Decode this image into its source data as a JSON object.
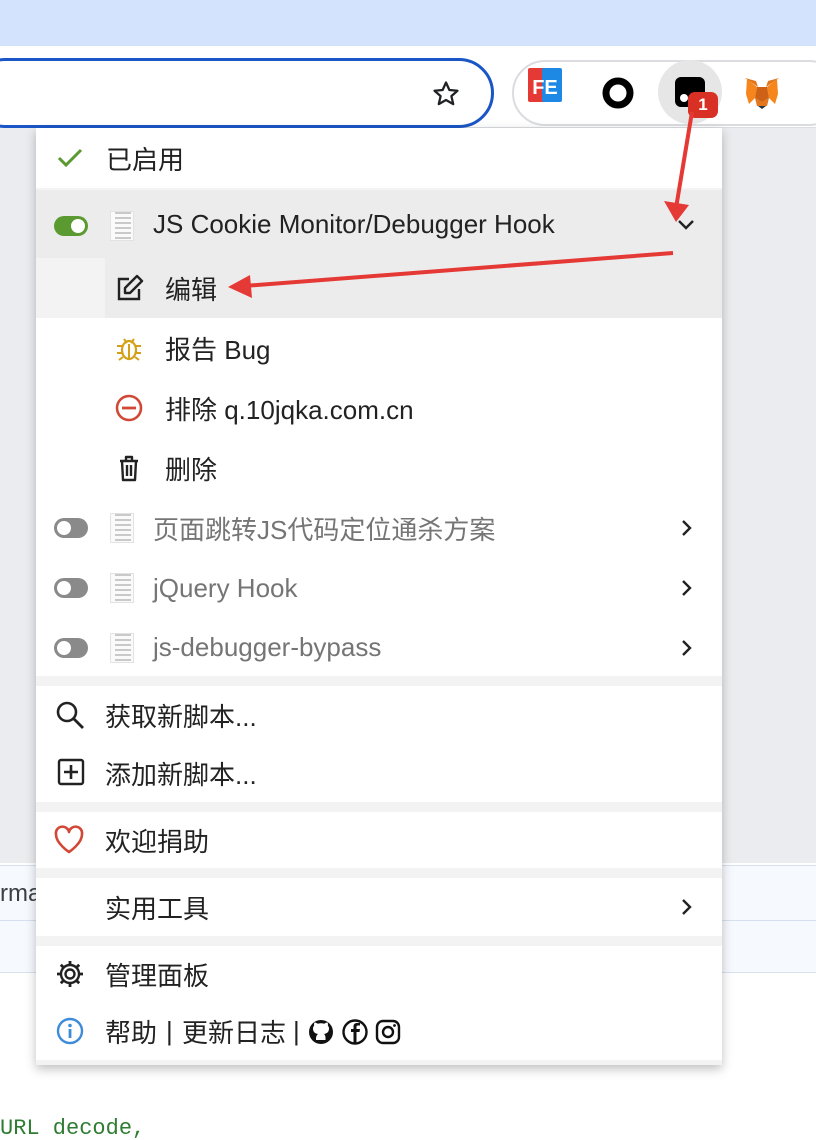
{
  "browser": {
    "badge_count": "1",
    "fe_label": "FE",
    "extensions": [
      "fe-helper-icon",
      "circle-extension-icon",
      "tampermonkey-icon",
      "metamask-fox-icon"
    ]
  },
  "page": {
    "partial_text": "rma",
    "code_text": "URL decode,"
  },
  "menu": {
    "enabled_label": "已启用",
    "active_script": {
      "name": "JS Cookie Monitor/Debugger Hook",
      "enabled": true,
      "actions": [
        {
          "label": "编辑",
          "icon": "edit-icon"
        },
        {
          "label": "报告 Bug",
          "icon": "bug-icon"
        },
        {
          "label": "排除 q.10jqka.com.cn",
          "icon": "exclude-icon"
        },
        {
          "label": "删除",
          "icon": "trash-icon"
        }
      ]
    },
    "scripts": [
      {
        "name": "页面跳转JS代码定位通杀方案",
        "enabled": false
      },
      {
        "name": "jQuery Hook",
        "enabled": false
      },
      {
        "name": "js-debugger-bypass",
        "enabled": false
      }
    ],
    "get_new_label": "获取新脚本...",
    "add_new_label": "添加新脚本...",
    "donate_label": "欢迎捐助",
    "utilities_label": "实用工具",
    "dashboard_label": "管理面板",
    "help_links": {
      "help": "帮助",
      "separator": "|",
      "changelog": "更新日志"
    }
  },
  "colors": {
    "accent_green": "#5a9a30",
    "arrow_red": "#e53935",
    "omnibox_border": "#1a56c6",
    "tab_strip": "#d3e3fd"
  }
}
